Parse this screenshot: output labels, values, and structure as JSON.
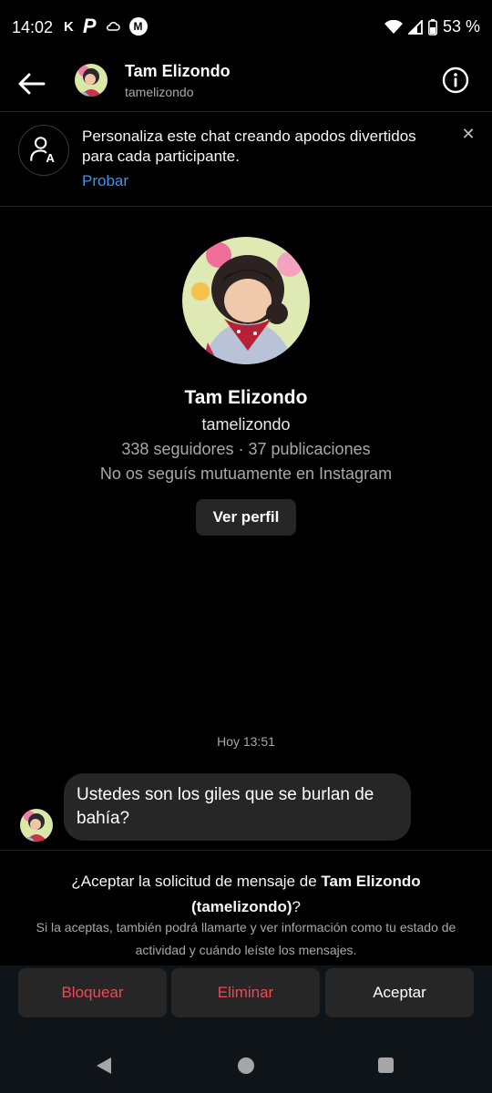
{
  "status_bar": {
    "time": "14:02",
    "left_icons": [
      "k-icon",
      "p-icon",
      "cloud-icon",
      "motorola-icon"
    ],
    "battery_percent": "53 %"
  },
  "header": {
    "name": "Tam Elizondo",
    "username": "tamelizondo"
  },
  "banner": {
    "text": "Personaliza este chat creando apodos divertidos para cada participante.",
    "link": "Probar"
  },
  "profile": {
    "name": "Tam Elizondo",
    "username": "tamelizondo",
    "stats": "338 seguidores · 37 publicaciones",
    "mutual": "No os seguís mutuamente en Instagram",
    "view_profile": "Ver perfil"
  },
  "conversation": {
    "timestamp": "Hoy 13:51",
    "messages": [
      {
        "text": "Ustedes son los giles que se burlan de bahía?"
      }
    ]
  },
  "request": {
    "prefix": "¿Aceptar la solicitud de mensaje de ",
    "name": "Tam Elizondo",
    "handle": "(tamelizondo)",
    "suffix": "?",
    "description": "Si la aceptas, también podrá llamarte y ver información como tu estado de actividad y cuándo leíste los mensajes."
  },
  "actions": {
    "block": "Bloquear",
    "delete": "Eliminar",
    "accept": "Aceptar"
  },
  "colors": {
    "background": "#000000",
    "link": "#4193ef",
    "danger": "#ed4956",
    "surface": "#262626"
  }
}
